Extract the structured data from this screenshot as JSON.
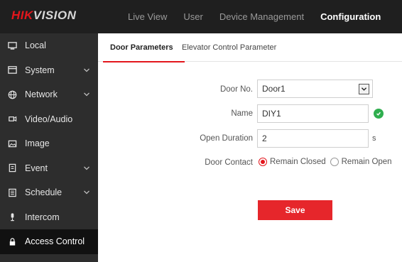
{
  "brand": {
    "logo_red": "HIK",
    "logo_white": "VISION",
    "accent_color": "#e3161c"
  },
  "topnav": {
    "items": [
      {
        "label": "Live View"
      },
      {
        "label": "User"
      },
      {
        "label": "Device Management"
      },
      {
        "label": "Configuration",
        "active": true
      }
    ]
  },
  "sidebar": {
    "items": [
      {
        "label": "Local",
        "icon": "monitor-icon"
      },
      {
        "label": "System",
        "icon": "system-icon",
        "expandable": true
      },
      {
        "label": "Network",
        "icon": "globe-icon",
        "expandable": true
      },
      {
        "label": "Video/Audio",
        "icon": "camera-icon"
      },
      {
        "label": "Image",
        "icon": "image-icon"
      },
      {
        "label": "Event",
        "icon": "event-icon",
        "expandable": true
      },
      {
        "label": "Schedule",
        "icon": "schedule-icon",
        "expandable": true
      },
      {
        "label": "Intercom",
        "icon": "intercom-icon"
      },
      {
        "label": "Access Control",
        "icon": "lock-icon",
        "active": true
      }
    ]
  },
  "tabs": [
    {
      "label": "Door Parameters",
      "active": true
    },
    {
      "label": "Elevator Control Parameter"
    }
  ],
  "form": {
    "door_no": {
      "label": "Door No.",
      "value": "Door1"
    },
    "name": {
      "label": "Name",
      "value": "DIY1",
      "valid": true
    },
    "open_duration": {
      "label": "Open Duration",
      "value": "2",
      "unit": "s"
    },
    "door_contact": {
      "label": "Door Contact",
      "options": [
        {
          "label": "Remain Closed",
          "checked": true
        },
        {
          "label": "Remain Open",
          "checked": false
        }
      ]
    },
    "save_label": "Save"
  }
}
